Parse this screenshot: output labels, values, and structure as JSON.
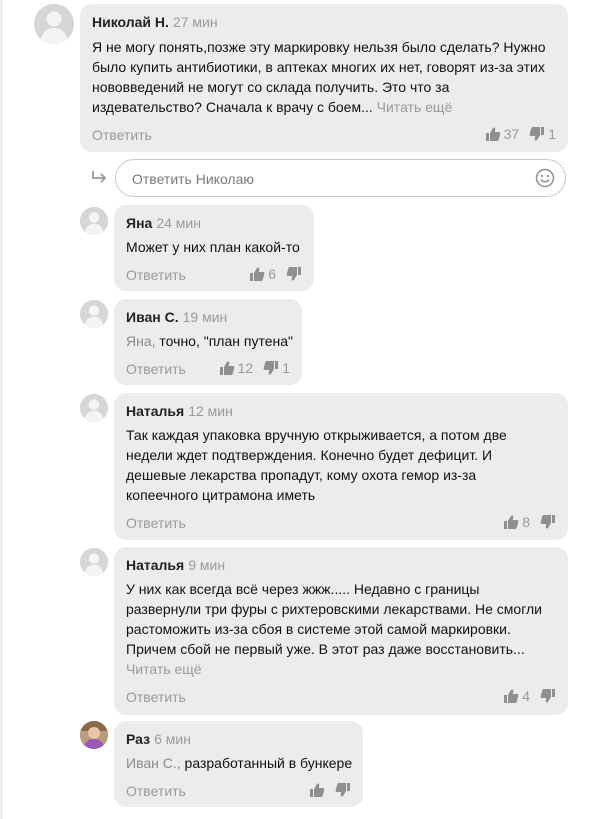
{
  "reply_label": "Ответить",
  "read_more": "Читать ещё",
  "reply_input": {
    "placeholder": "Ответить Николаю"
  },
  "comments": [
    {
      "author": "Николай Н.",
      "time": "27 мин",
      "text": "Я не могу понять,позже эту маркировку нельзя было сделать? Нужно было купить антибиотики, в аптеках многих их нет, говорят из-за этих нововведений не могут со склада получить. Это что за издевательство? Сначала к врачу с боем...",
      "likes": "37",
      "dislikes": "1"
    },
    {
      "author": "Яна",
      "time": "24 мин",
      "text": "Может у них план какой-то",
      "likes": "6",
      "dislikes": ""
    },
    {
      "author": "Иван С.",
      "time": "19 мин",
      "mention": "Яна,",
      "text": "точно, \"план путена\"",
      "likes": "12",
      "dislikes": "1"
    },
    {
      "author": "Наталья",
      "time": "12 мин",
      "text": "Так каждая упаковка вручную открыживается, а потом две недели ждет подтверждения. Конечно будет дефицит. И дешевые лекарства пропадут, кому охота гемор из-за копеечного цитрамона иметь",
      "likes": "8",
      "dislikes": ""
    },
    {
      "author": "Наталья",
      "time": "9 мин",
      "text": "У них как всегда всё через жжж..... Недавно с границы развернули три фуры с рихтеровскими лекарствами. Не смогли растоможить из-за сбоя в системе этой самой маркировки. Причем сбой не первый уже. В этот раз даже восстановить...",
      "likes": "4",
      "dislikes": ""
    },
    {
      "author": "Раз",
      "time": "6 мин",
      "mention": "Иван С.,",
      "text": "разработанный в бункере",
      "likes": "",
      "dislikes": ""
    }
  ],
  "icons": {
    "avatar_placeholder": "user-silhouette-icon",
    "like": "thumbs-up-icon",
    "dislike": "thumbs-down-icon",
    "emoji": "smiley-icon",
    "reply_arrow": "reply-arrow-icon"
  }
}
